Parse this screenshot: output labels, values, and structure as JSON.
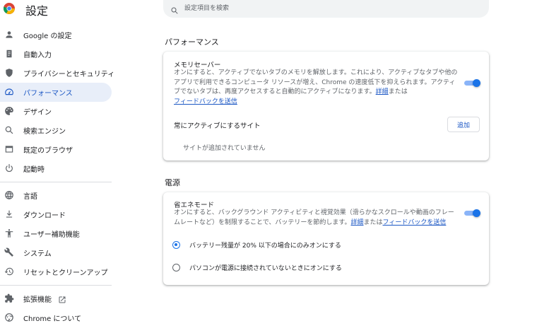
{
  "app": {
    "title": "設定"
  },
  "search": {
    "placeholder": "設定項目を検索"
  },
  "sidebar": {
    "items": [
      {
        "label": "Google の設定",
        "icon": "person-icon"
      },
      {
        "label": "自動入力",
        "icon": "clipboard-icon"
      },
      {
        "label": "プライバシーとセキュリティ",
        "icon": "shield-icon"
      },
      {
        "label": "パフォーマンス",
        "icon": "speedometer-icon",
        "active": true
      },
      {
        "label": "デザイン",
        "icon": "palette-icon"
      },
      {
        "label": "検索エンジン",
        "icon": "search-icon"
      },
      {
        "label": "既定のブラウザ",
        "icon": "browser-icon"
      },
      {
        "label": "起動時",
        "icon": "power-icon"
      }
    ],
    "items2": [
      {
        "label": "言語",
        "icon": "globe-icon"
      },
      {
        "label": "ダウンロード",
        "icon": "download-icon"
      },
      {
        "label": "ユーザー補助機能",
        "icon": "accessibility-icon"
      },
      {
        "label": "システム",
        "icon": "wrench-icon"
      },
      {
        "label": "リセットとクリーンアップ",
        "icon": "history-icon"
      }
    ],
    "items3": [
      {
        "label": "拡張機能",
        "icon": "puzzle-icon"
      },
      {
        "label": "Chrome について",
        "icon": "chrome-icon"
      }
    ]
  },
  "performance": {
    "section_title": "パフォーマンス",
    "memory_saver": {
      "title": "メモリセーバー",
      "desc": "オンにすると、アクティブでないタブのメモリを解放します。これにより、アクティブなタブや他のアプリで利用できるコンピュータ リソースが増え、Chrome の速度低下を抑えられます。アクティブでないタブは、再度アクセスすると自動的にアクティブになります。",
      "link_details": "詳細",
      "or": "または",
      "link_feedback": "フィードバックを送信",
      "enabled": true
    },
    "always_active": {
      "label": "常にアクティブにするサイト",
      "add_label": "追加",
      "empty": "サイトが追加されていません"
    }
  },
  "power": {
    "section_title": "電源",
    "energy_saver": {
      "title": "省エネモード",
      "desc": "オンにすると、バックグラウンド アクティビティと視覚効果（滑らかなスクロールや動画のフレームレートなど）を制限することで、バッテリーを節約します。",
      "link_details": "詳細",
      "or": "または",
      "link_feedback": "フィードバックを送信",
      "enabled": true
    },
    "options": [
      {
        "label": "バッテリー残量が 20% 以下の場合にのみオンにする",
        "selected": true
      },
      {
        "label": "パソコンが電源に接続されていないときにオンにする",
        "selected": false
      }
    ]
  },
  "colors": {
    "accent": "#1a73e8",
    "active_bg": "#e8eef9",
    "link": "#1a56c4"
  }
}
